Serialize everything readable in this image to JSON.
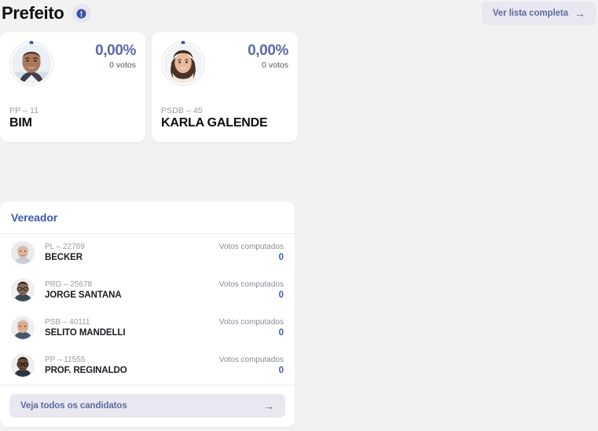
{
  "header": {
    "title": "Prefeito",
    "info_icon": "info-icon",
    "full_list_label": "Ver lista completa",
    "arrow_icon": "arrow-right-icon"
  },
  "colors": {
    "background": "#f2f2f3",
    "card": "#ffffff",
    "accent_blue": "#3c5aab",
    "accent_slate": "#5d6aa8",
    "button_bg": "#e9e8f1",
    "muted_text": "#9a9aa6"
  },
  "prefeito": {
    "candidates": [
      {
        "percent": "0,00%",
        "votes": "0 votos",
        "party": "PP – 11",
        "name": "BIM",
        "avatar": "candidate-photo"
      },
      {
        "percent": "0,00%",
        "votes": "0 votos",
        "party": "PSDB – 45",
        "name": "KARLA GALENDE",
        "avatar": "candidate-photo"
      }
    ]
  },
  "vereador": {
    "title": "Vereador",
    "rows": [
      {
        "party": "PL – 22789",
        "name": "BECKER",
        "votes_label": "Votos computados",
        "votes_value": "0",
        "avatar": "candidate-photo"
      },
      {
        "party": "PRD – 25678",
        "name": "JORGE SANTANA",
        "votes_label": "Votos computados",
        "votes_value": "0",
        "avatar": "candidate-photo"
      },
      {
        "party": "PSB – 40111",
        "name": "SELITO MANDELLI",
        "votes_label": "Votos computados",
        "votes_value": "0",
        "avatar": "candidate-photo"
      },
      {
        "party": "PP – 11555",
        "name": "PROF. REGINALDO",
        "votes_label": "Votos computados",
        "votes_value": "0",
        "avatar": "candidate-photo"
      }
    ],
    "all_candidates_label": "Veja todos os candidatos",
    "arrow_icon": "arrow-right-icon"
  }
}
